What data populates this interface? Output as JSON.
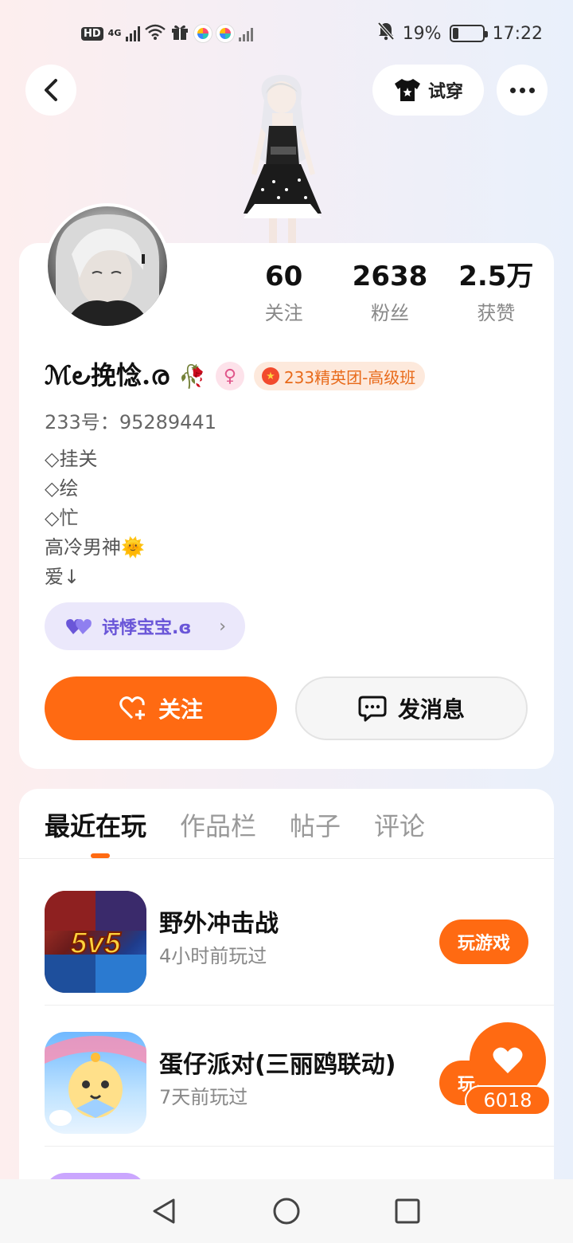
{
  "status_bar": {
    "hd": "HD",
    "network": "4G",
    "battery_text": "19%",
    "battery_level": 0.19,
    "time": "17:22"
  },
  "header": {
    "tryon_label": "试穿"
  },
  "profile": {
    "stats": [
      {
        "value": "60",
        "label": "关注"
      },
      {
        "value": "2638",
        "label": "粉丝"
      },
      {
        "value": "2.5万",
        "label": "获赞"
      }
    ],
    "username": "ℳ౿挽惗.ര",
    "badge": "233精英团-高级班",
    "uid_label": "233号：",
    "uid": "95289441",
    "bio": [
      "◇挂关",
      "◇绘",
      "◇忙",
      "高冷男神🌞",
      "爱↓"
    ],
    "relation_chip": "诗悸宝宝.ɞ",
    "follow_label": "关注",
    "message_label": "发消息"
  },
  "tabs": [
    {
      "label": "最近在玩",
      "active": true
    },
    {
      "label": "作品栏",
      "active": false
    },
    {
      "label": "帖子",
      "active": false
    },
    {
      "label": "评论",
      "active": false
    }
  ],
  "games": [
    {
      "name": "野外冲击战",
      "time": "4小时前玩过",
      "button": "玩游戏",
      "icon_text": "5v5"
    },
    {
      "name": "蛋仔派对(三丽鸥联动)",
      "time": "7天前玩过",
      "button": "玩游戏"
    }
  ],
  "like": {
    "count": "6018"
  },
  "colors": {
    "accent": "#ff6a12",
    "chip_purple": "#6a56d8"
  }
}
